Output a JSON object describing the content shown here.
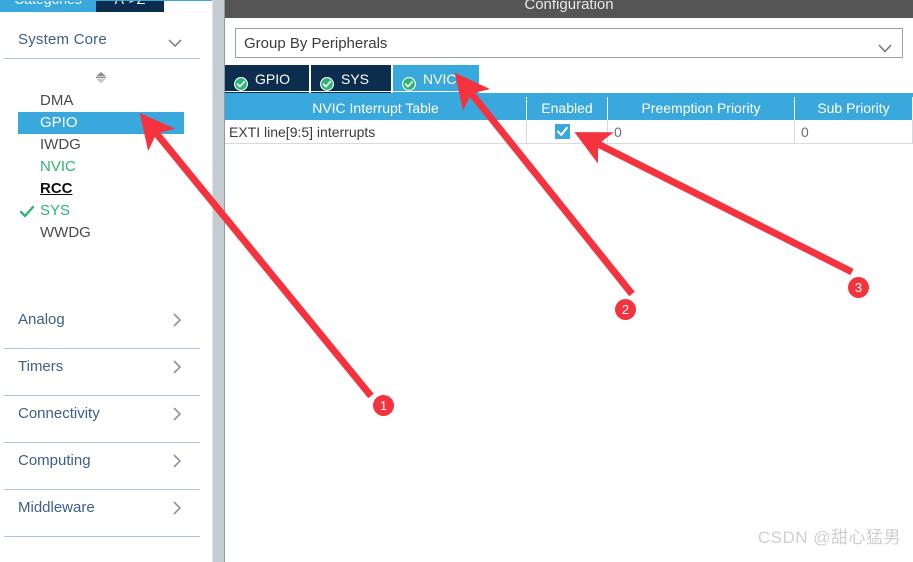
{
  "left_panel": {
    "tabs": [
      {
        "label": "Categories",
        "active": true
      },
      {
        "label": "A->Z",
        "active": false
      }
    ],
    "group_header": {
      "label": "System Core",
      "chevron": "chevron-down-icon"
    },
    "peripherals": [
      {
        "label": "DMA",
        "state": "normal",
        "checked": false
      },
      {
        "label": "GPIO",
        "state": "selected",
        "checked": false
      },
      {
        "label": "IWDG",
        "state": "normal",
        "checked": false
      },
      {
        "label": "NVIC",
        "state": "configured",
        "checked": false
      },
      {
        "label": "RCC",
        "state": "warning",
        "checked": false
      },
      {
        "label": "SYS",
        "state": "configured",
        "checked": true
      },
      {
        "label": "WWDG",
        "state": "normal",
        "checked": false
      }
    ],
    "categories": [
      {
        "label": "Analog",
        "chevron": "chevron-right-icon"
      },
      {
        "label": "Timers",
        "chevron": "chevron-right-icon"
      },
      {
        "label": "Connectivity",
        "chevron": "chevron-right-icon"
      },
      {
        "label": "Computing",
        "chevron": "chevron-right-icon"
      },
      {
        "label": "Middleware",
        "chevron": "chevron-right-icon"
      }
    ]
  },
  "right_panel": {
    "title": "Configuration",
    "group_by": {
      "value": "Group By Peripherals",
      "chevron": "chevron-down-icon"
    },
    "peripheral_tabs": [
      {
        "label": "GPIO",
        "active": false,
        "icon": "green-check-circle-icon"
      },
      {
        "label": "SYS",
        "active": false,
        "icon": "green-check-circle-icon"
      },
      {
        "label": "NVIC",
        "active": true,
        "icon": "green-check-circle-icon"
      }
    ],
    "table": {
      "headers": [
        "NVIC Interrupt Table",
        "Enabled",
        "Preemption Priority",
        "Sub Priority"
      ],
      "rows": [
        {
          "name": "EXTI line[9:5] interrupts",
          "enabled": true,
          "preemption_priority": "0",
          "sub_priority": "0"
        }
      ]
    }
  },
  "annotations": {
    "markers": [
      {
        "label": "1"
      },
      {
        "label": "2"
      },
      {
        "label": "3"
      }
    ],
    "arrow_color": "#f5333f"
  },
  "watermark": {
    "text": "CSDN @甜心猛男"
  },
  "colors": {
    "accent_blue": "#39a8dc",
    "tab_navy": "#0d2d4e",
    "green": "#2bb673",
    "title_bar": "#555555",
    "marker_red": "#f5333f"
  }
}
